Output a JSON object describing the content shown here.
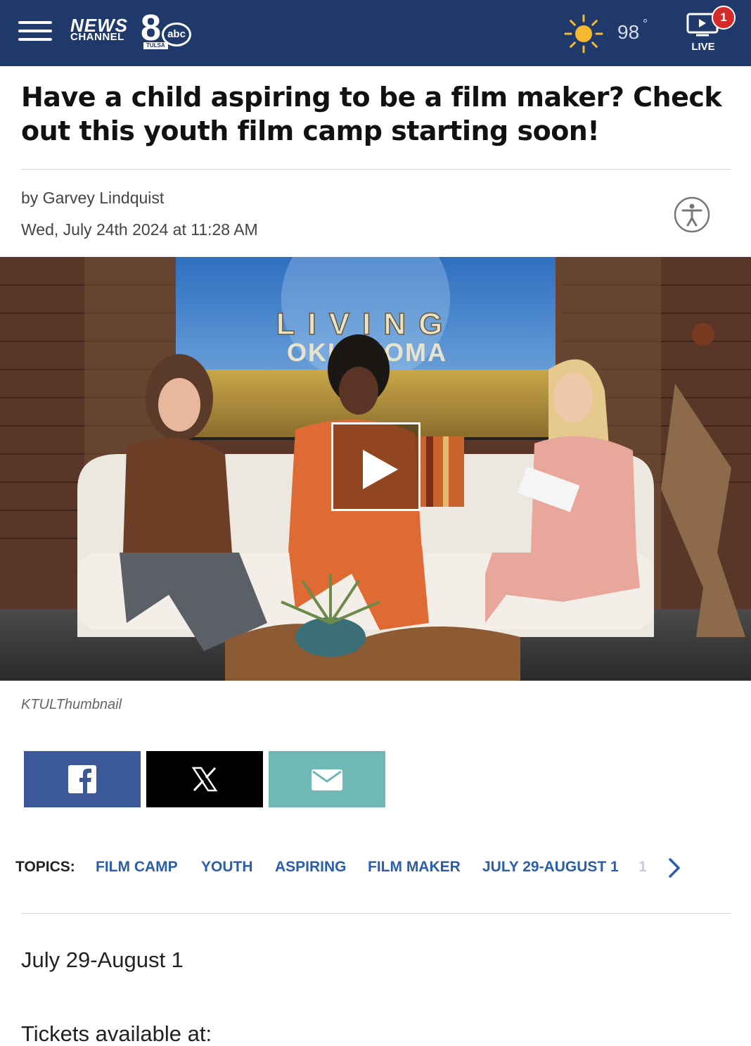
{
  "header": {
    "logo": {
      "news": "NEWS",
      "channel": "CHANNEL",
      "number": "8",
      "network": "abc",
      "city": "TULSA"
    },
    "weather": {
      "temperature": "98",
      "degree_symbol": "°",
      "icon": "sun-icon"
    },
    "live": {
      "label": "LIVE",
      "badge_count": "1",
      "icon": "tv-play-icon"
    },
    "colors": {
      "bar": "#1f3a6a",
      "badge": "#d42a2a",
      "sun": "#f5b82e"
    }
  },
  "article": {
    "headline": "Have a child aspiring to be a film maker? Check out this youth film camp starting soon!",
    "byline": "by Garvey Lindquist",
    "date": "Wed, July 24th 2024 at 11:28 AM",
    "video": {
      "backdrop_line1": "LIVING",
      "backdrop_line2": "OKLAHOMA",
      "caption": "KTULThumbnail"
    }
  },
  "share": {
    "buttons": [
      {
        "name": "facebook",
        "icon": "facebook-icon",
        "color": "#3b5998"
      },
      {
        "name": "x",
        "icon": "x-icon",
        "color": "#000000"
      },
      {
        "name": "email",
        "icon": "mail-icon",
        "color": "#6fb8b5"
      }
    ]
  },
  "topics": {
    "label": "TOPICS:",
    "items": [
      "FILM CAMP",
      "YOUTH",
      "ASPIRING",
      "FILM MAKER",
      "JULY 29-AUGUST 1"
    ],
    "overflow_hint": "1",
    "link_color": "#2a5ea8"
  },
  "body": {
    "paragraphs": [
      "July 29-August 1",
      "Tickets available at:"
    ]
  }
}
